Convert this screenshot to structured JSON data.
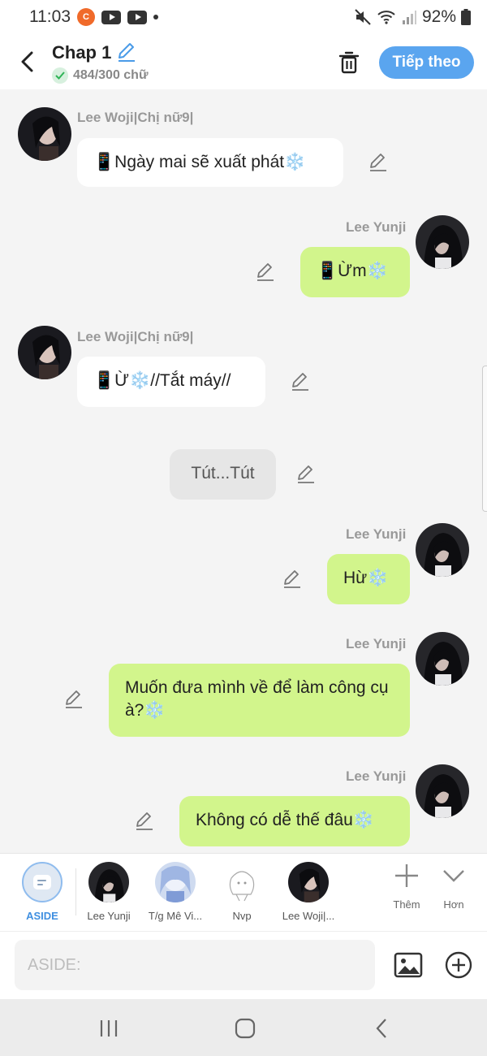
{
  "status_bar": {
    "time": "11:03",
    "battery": "92%",
    "app_icon": "app-icon",
    "icons": [
      "youtube-icon",
      "youtube-icon",
      "mute-icon",
      "wifi-icon",
      "signal-icon",
      "battery-icon"
    ]
  },
  "header": {
    "title": "Chap 1",
    "word_count": "484/300 chữ",
    "next_label": "Tiếp theo"
  },
  "messages": [
    {
      "side": "left",
      "sender": "Lee Woji|Chị nữ9|",
      "text": "📱Ngày mai sẽ xuất phát❄️"
    },
    {
      "side": "right",
      "sender": "Lee Yunji",
      "text": "📱Ừm❄️"
    },
    {
      "side": "left",
      "sender": "Lee Woji|Chị nữ9|",
      "text": "📱Ừ❄️//Tắt máy//"
    },
    {
      "side": "center",
      "sender": "",
      "text": "Tút...Tút"
    },
    {
      "side": "right",
      "sender": "Lee Yunji",
      "text": "Hừ❄️"
    },
    {
      "side": "right",
      "sender": "Lee Yunji",
      "text": "Muốn đưa mình về để làm công cụ à?❄️"
    },
    {
      "side": "right",
      "sender": "Lee Yunji",
      "text": "Không có dễ thế đâu❄️"
    }
  ],
  "characters": [
    {
      "name": "ASIDE",
      "active": true
    },
    {
      "name": "Lee Yunji",
      "active": false
    },
    {
      "name": "T/g Mê Vi...",
      "active": false
    },
    {
      "name": "Nvp",
      "active": false
    },
    {
      "name": "Lee Woji|...",
      "active": false
    }
  ],
  "char_actions": {
    "add_label": "Thêm",
    "more_label": "Hơn"
  },
  "input": {
    "placeholder": "ASIDE:",
    "value": ""
  },
  "colors": {
    "accent": "#5aa5ef",
    "bubble_right": "#d2f58c",
    "bubble_left": "#ffffff",
    "bubble_center": "#e6e6e6",
    "background": "#f4f4f4"
  }
}
